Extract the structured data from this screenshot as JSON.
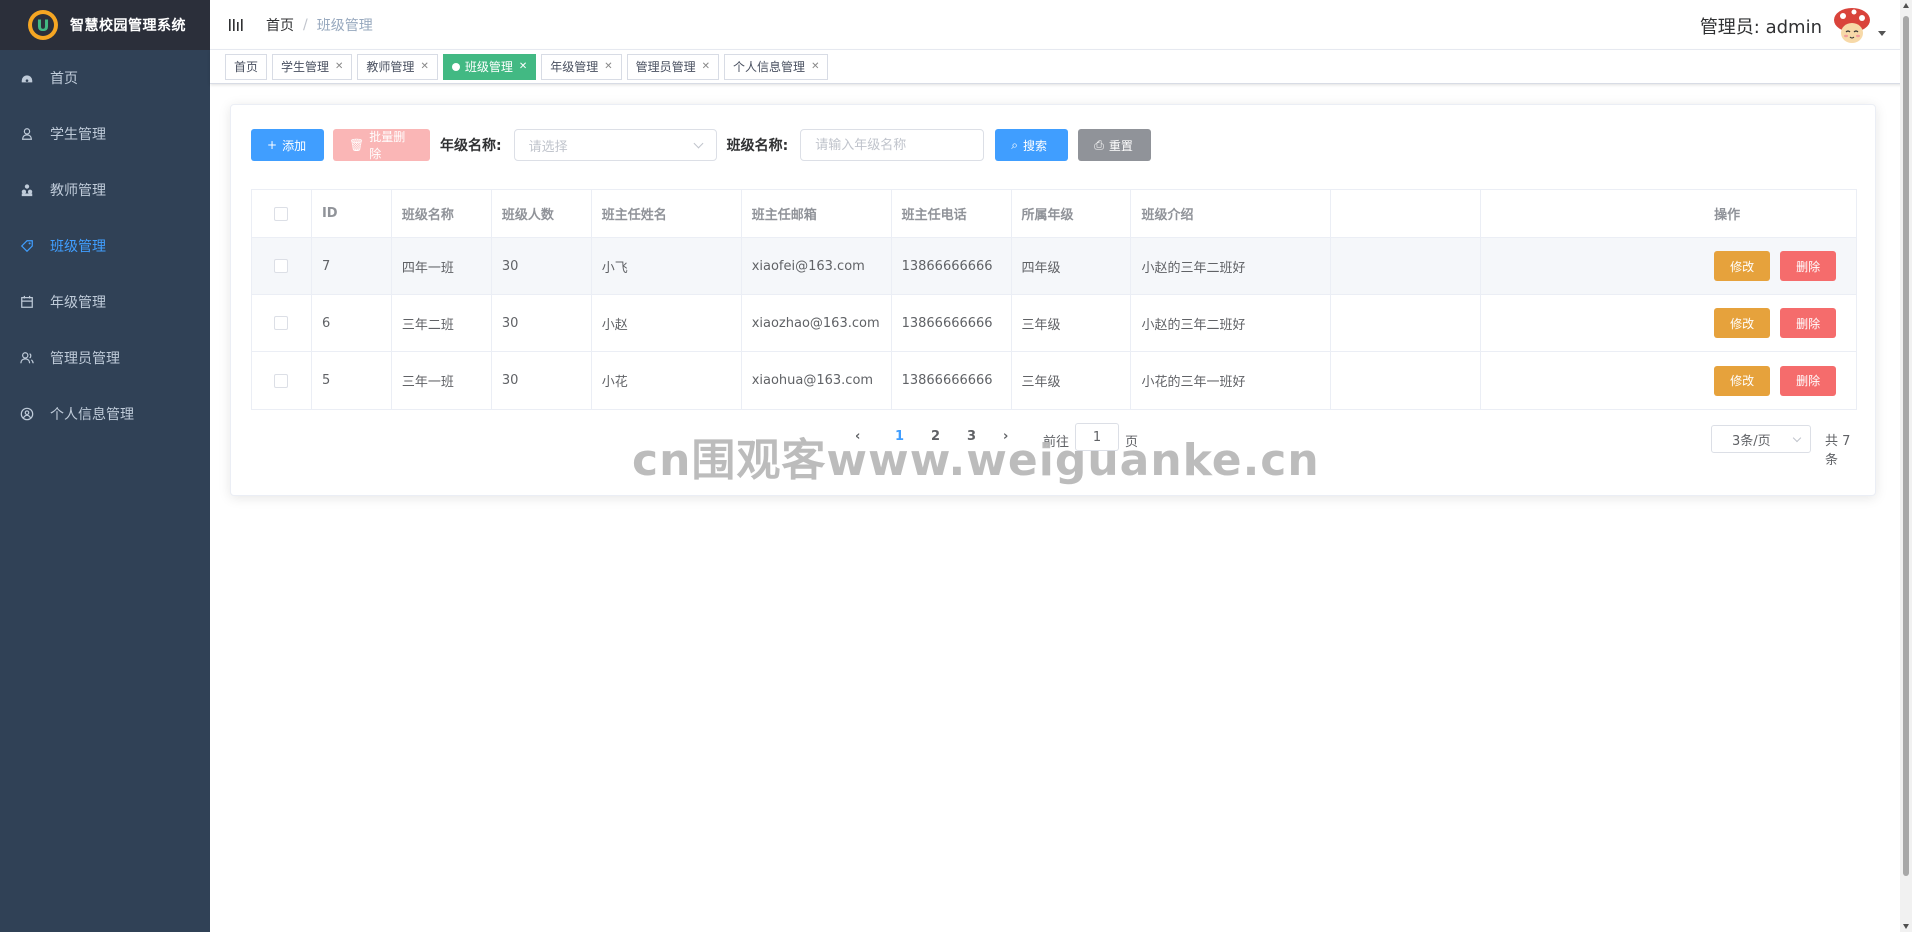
{
  "app": {
    "title": "智慧校园管理系统",
    "logo_letter": "U"
  },
  "sidebar": {
    "items": [
      {
        "label": "首页",
        "icon": "dashboard-icon",
        "active": false
      },
      {
        "label": "学生管理",
        "icon": "user-icon",
        "active": false
      },
      {
        "label": "教师管理",
        "icon": "people-icon",
        "active": false
      },
      {
        "label": "班级管理",
        "icon": "tag-icon",
        "active": true
      },
      {
        "label": "年级管理",
        "icon": "calendar-icon",
        "active": false
      },
      {
        "label": "管理员管理",
        "icon": "admin-icon",
        "active": false
      },
      {
        "label": "个人信息管理",
        "icon": "profile-icon",
        "active": false
      }
    ]
  },
  "header": {
    "breadcrumb": {
      "home": "首页",
      "separator": "/",
      "current": "班级管理"
    },
    "user_label": "管理员: admin"
  },
  "tags": [
    {
      "label": "首页",
      "closable": false,
      "active": false
    },
    {
      "label": "学生管理",
      "closable": true,
      "active": false
    },
    {
      "label": "教师管理",
      "closable": true,
      "active": false
    },
    {
      "label": "班级管理",
      "closable": true,
      "active": true
    },
    {
      "label": "年级管理",
      "closable": true,
      "active": false
    },
    {
      "label": "管理员管理",
      "closable": true,
      "active": false
    },
    {
      "label": "个人信息管理",
      "closable": true,
      "active": false
    }
  ],
  "toolbar": {
    "add_label": "添加",
    "batch_delete_label": "批量删除",
    "grade_filter_label": "年级名称:",
    "grade_select_placeholder": "请选择",
    "class_filter_label": "班级名称:",
    "class_input_placeholder": "请输入年级名称",
    "search_label": "搜索",
    "reset_label": "重置"
  },
  "table": {
    "headers": [
      "ID",
      "班级名称",
      "班级人数",
      "班主任姓名",
      "班主任邮箱",
      "班主任电话",
      "所属年级",
      "班级介绍",
      "操作"
    ],
    "rows": [
      {
        "id": "7",
        "name": "四年一班",
        "count": "30",
        "teacher": "小飞",
        "email": "xiaofei@163.com",
        "phone": "13866666666",
        "grade": "四年级",
        "desc": "小赵的三年二班好"
      },
      {
        "id": "6",
        "name": "三年二班",
        "count": "30",
        "teacher": "小赵",
        "email": "xiaozhao@163.com",
        "phone": "13866666666",
        "grade": "三年级",
        "desc": "小赵的三年二班好"
      },
      {
        "id": "5",
        "name": "三年一班",
        "count": "30",
        "teacher": "小花",
        "email": "xiaohua@163.com",
        "phone": "13866666666",
        "grade": "三年级",
        "desc": "小花的三年一班好"
      }
    ],
    "edit_label": "修改",
    "delete_label": "删除"
  },
  "pagination": {
    "prev": "‹",
    "pages": [
      "1",
      "2",
      "3"
    ],
    "current": "1",
    "next": "›",
    "goto_label": "前往",
    "goto_value": "1",
    "goto_suffix": "页",
    "page_size": "3条/页",
    "total": "共 7 条"
  },
  "watermark": "cn围观客www.weiguanke.cn",
  "colors": {
    "sidebar_bg": "#304156",
    "active": "#409eff",
    "tag_active": "#42b983"
  }
}
